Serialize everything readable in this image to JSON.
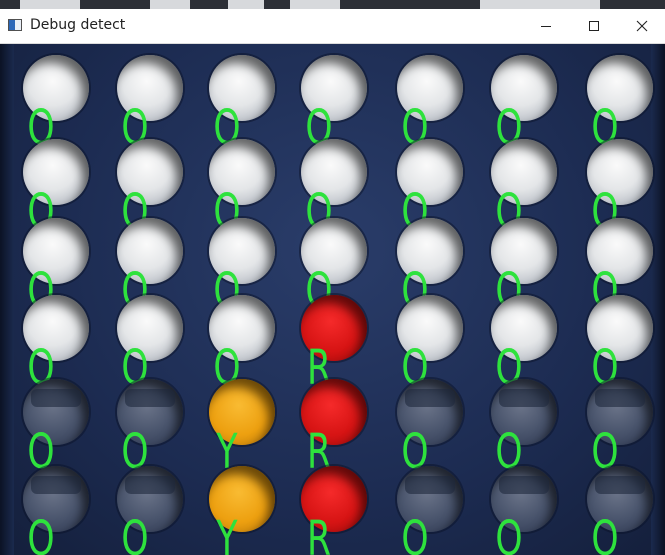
{
  "window": {
    "title": "Debug detect",
    "controls": {
      "minimize": "minimize-icon",
      "maximize": "maximize-icon",
      "close": "close-icon"
    }
  },
  "board": {
    "rows": 6,
    "cols": 7,
    "cells": [
      [
        "O",
        "O",
        "O",
        "O",
        "O",
        "O",
        "O"
      ],
      [
        "O",
        "O",
        "O",
        "O",
        "O",
        "O",
        "O"
      ],
      [
        "O",
        "O",
        "O",
        "O",
        "O",
        "O",
        "O"
      ],
      [
        "O",
        "O",
        "O",
        "R",
        "O",
        "O",
        "O"
      ],
      [
        "O",
        "O",
        "Y",
        "R",
        "O",
        "O",
        "O"
      ],
      [
        "O",
        "O",
        "Y",
        "R",
        "O",
        "O",
        "O"
      ]
    ],
    "piece_colors": {
      "R": "#d71414",
      "Y": "#eda010",
      "label": "#2ee23d",
      "board": "#1c2b51"
    }
  }
}
